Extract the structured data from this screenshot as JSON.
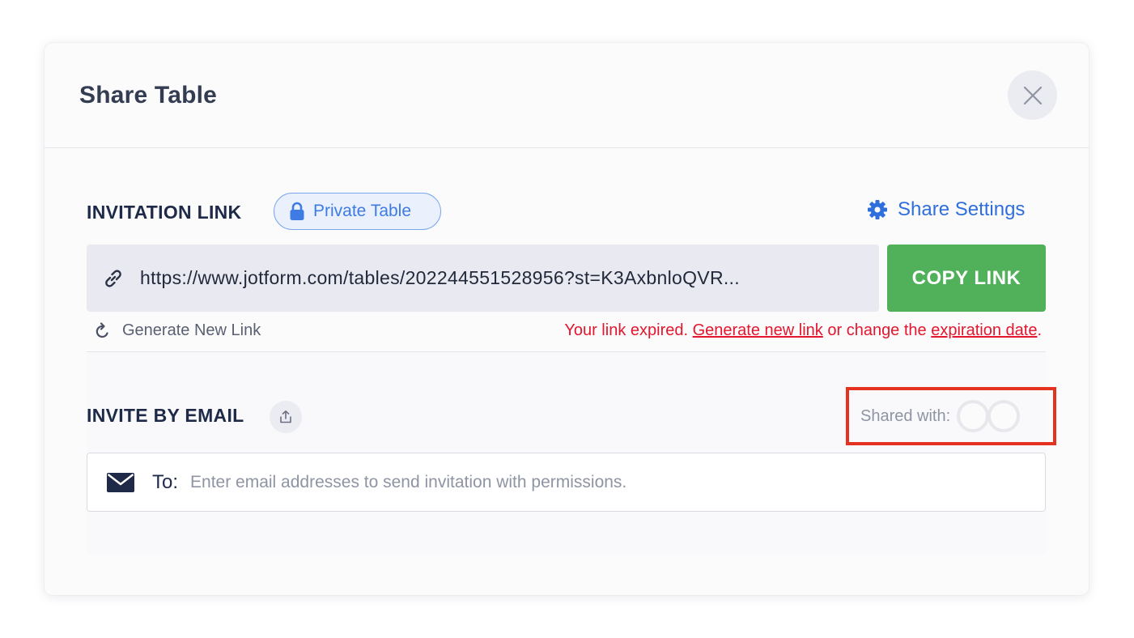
{
  "modal": {
    "title": "Share Table",
    "close_icon": "close-icon"
  },
  "invitation": {
    "section_title": "INVITATION LINK",
    "privacy_badge": "Private Table",
    "privacy_icon": "lock-icon",
    "share_settings_label": "Share Settings",
    "share_settings_icon": "gear-icon",
    "link_icon": "link-icon",
    "url": "https://www.jotform.com/tables/202244551528956?st=K3AxbnloQVR...",
    "copy_label": "COPY LINK",
    "generate_label": "Generate New Link",
    "generate_icon": "refresh-icon",
    "expired_text_1": "Your link expired. ",
    "expired_link_1": "Generate new link",
    "expired_text_2": " or change the ",
    "expired_link_2": "expiration date",
    "expired_text_3": "."
  },
  "invite_email": {
    "section_title": "INVITE BY EMAIL",
    "upload_icon": "upload-icon",
    "shared_with_label": "Shared with:",
    "to_label": "To:",
    "placeholder": "Enter email addresses to send invitation with permissions.",
    "mail_icon": "envelope-icon"
  },
  "colors": {
    "accent_blue": "#2f6fdd",
    "copy_green": "#50b15a",
    "error_red": "#e4162d",
    "highlight_red": "#e5311f"
  }
}
